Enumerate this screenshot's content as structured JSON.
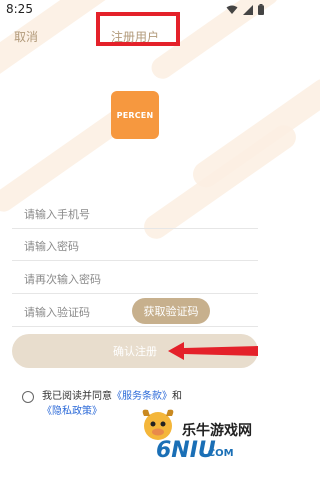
{
  "status_bar": {
    "time": "8:25",
    "icons": [
      "wifi-icon",
      "signal-icon",
      "battery-icon"
    ]
  },
  "nav": {
    "cancel_label": "取消",
    "title": "注册用户"
  },
  "logo": {
    "text": "PERCEN",
    "color": "#f6983f"
  },
  "form": {
    "phone_placeholder": "请输入手机号",
    "password_placeholder": "请输入密码",
    "confirm_password_placeholder": "请再次输入密码",
    "code_placeholder": "请输入验证码",
    "get_code_label": "获取验证码",
    "confirm_label": "确认注册"
  },
  "agreement": {
    "prefix": "我已阅读并同意",
    "service_terms": "《服务条款》",
    "and": "和",
    "privacy_policy": "《隐私政策》"
  },
  "watermark": {
    "line1": "乐牛游戏网",
    "line2": "6NIU",
    "suffix": ".COM"
  },
  "colors": {
    "accent": "#c7b08d",
    "confirm_bg": "#e8ddcd",
    "highlight_box": "#e4212a",
    "link": "#2c6ad8"
  }
}
